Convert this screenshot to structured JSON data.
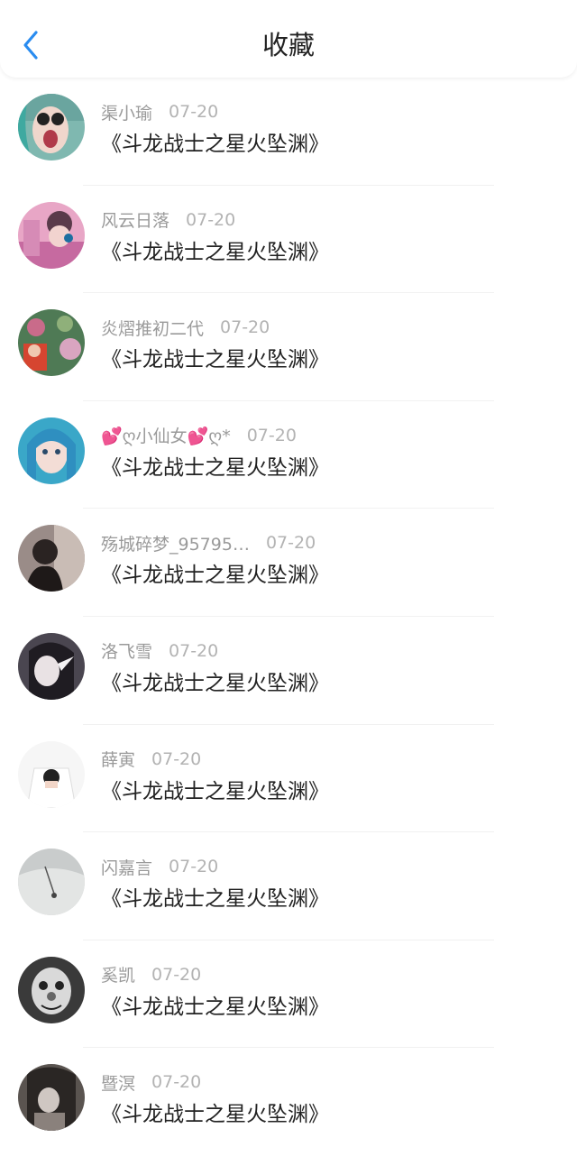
{
  "header": {
    "title": "收藏",
    "back_icon": "chevron-left-icon",
    "accent_color": "#2a8cf0"
  },
  "items": [
    {
      "name": "渠小瑜",
      "date": "07-20",
      "work": "《斗龙战士之星火坠渊》"
    },
    {
      "name": "风云日落",
      "date": "07-20",
      "work": "《斗龙战士之星火坠渊》"
    },
    {
      "name": "炎熠推初二代",
      "date": "07-20",
      "work": "《斗龙战士之星火坠渊》"
    },
    {
      "name": "💕ღ小仙女💕ღ*",
      "date": "07-20",
      "work": "《斗龙战士之星火坠渊》"
    },
    {
      "name": "殇城碎梦_95795…",
      "date": "07-20",
      "work": "《斗龙战士之星火坠渊》"
    },
    {
      "name": "洛飞雪",
      "date": "07-20",
      "work": "《斗龙战士之星火坠渊》"
    },
    {
      "name": "薛寅",
      "date": "07-20",
      "work": "《斗龙战士之星火坠渊》"
    },
    {
      "name": "闪嘉言",
      "date": "07-20",
      "work": "《斗龙战士之星火坠渊》"
    },
    {
      "name": "奚凯",
      "date": "07-20",
      "work": "《斗龙战士之星火坠渊》"
    },
    {
      "name": "暨溟",
      "date": "07-20",
      "work": "《斗龙战士之星火坠渊》"
    }
  ]
}
